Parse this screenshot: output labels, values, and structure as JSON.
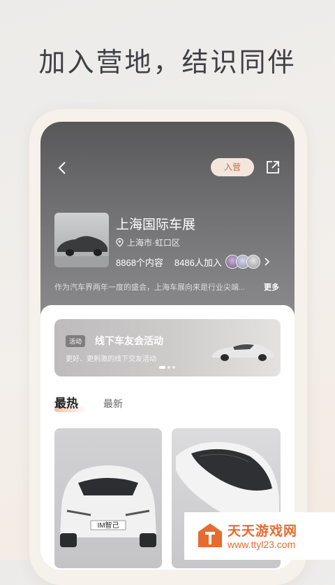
{
  "headline": "加入营地，结识同伴",
  "header": {
    "join_label": "入营",
    "icons": {
      "back": "chevron-left-icon",
      "share": "share-icon"
    }
  },
  "camp": {
    "name": "上海国际车展",
    "location": "上海市·虹口区",
    "content_count": "8868个内容",
    "member_count": "8486人加入",
    "description": "作为汽车界两年一度的盛会，上海车展向来是行业尖端...",
    "more_label": "更多"
  },
  "banner": {
    "tag": "活动",
    "title": "线下车友会活动",
    "subtitle": "更好、更刺激的线下交友活动"
  },
  "tabs": [
    {
      "label": "最热",
      "active": true
    },
    {
      "label": "最新",
      "active": false
    }
  ],
  "cards": [
    {
      "plate_text": "IM智己"
    }
  ],
  "watermark": {
    "title": "天天游戏网",
    "url": "www.ttyl23.com"
  },
  "colors": {
    "accent": "#c06a45",
    "join_bg": "#f4e6dc",
    "watermark": "#e86a2f"
  }
}
